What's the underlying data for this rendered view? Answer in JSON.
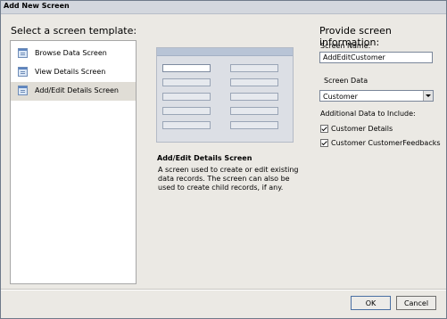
{
  "window": {
    "title": "Add New Screen"
  },
  "left": {
    "heading": "Select a screen template:",
    "templates": [
      {
        "label": "Browse Data Screen",
        "icon": "browse-screen-icon"
      },
      {
        "label": "View Details Screen",
        "icon": "details-screen-icon"
      },
      {
        "label": "Add/Edit Details Screen",
        "icon": "edit-screen-icon",
        "selected": true
      }
    ]
  },
  "center": {
    "description_title": "Add/Edit Details Screen",
    "description": "A screen used to create or edit existing data records. The screen can also be used to create child records, if any."
  },
  "right": {
    "heading": "Provide screen information:",
    "screen_name_label": "Screen Name:",
    "screen_name_value": "AddEditCustomer",
    "screen_data_label": "Screen Data",
    "screen_data_value": "Customer",
    "additional_label": "Additional Data to Include:",
    "options": [
      {
        "label": "Customer Details",
        "checked": true
      },
      {
        "label": "Customer CustomerFeedbacks",
        "checked": true
      }
    ]
  },
  "buttons": {
    "ok": "OK",
    "cancel": "Cancel"
  },
  "colors": {
    "selected_row": "#e0ddd6",
    "dialog_bg": "#ebe9e4"
  }
}
